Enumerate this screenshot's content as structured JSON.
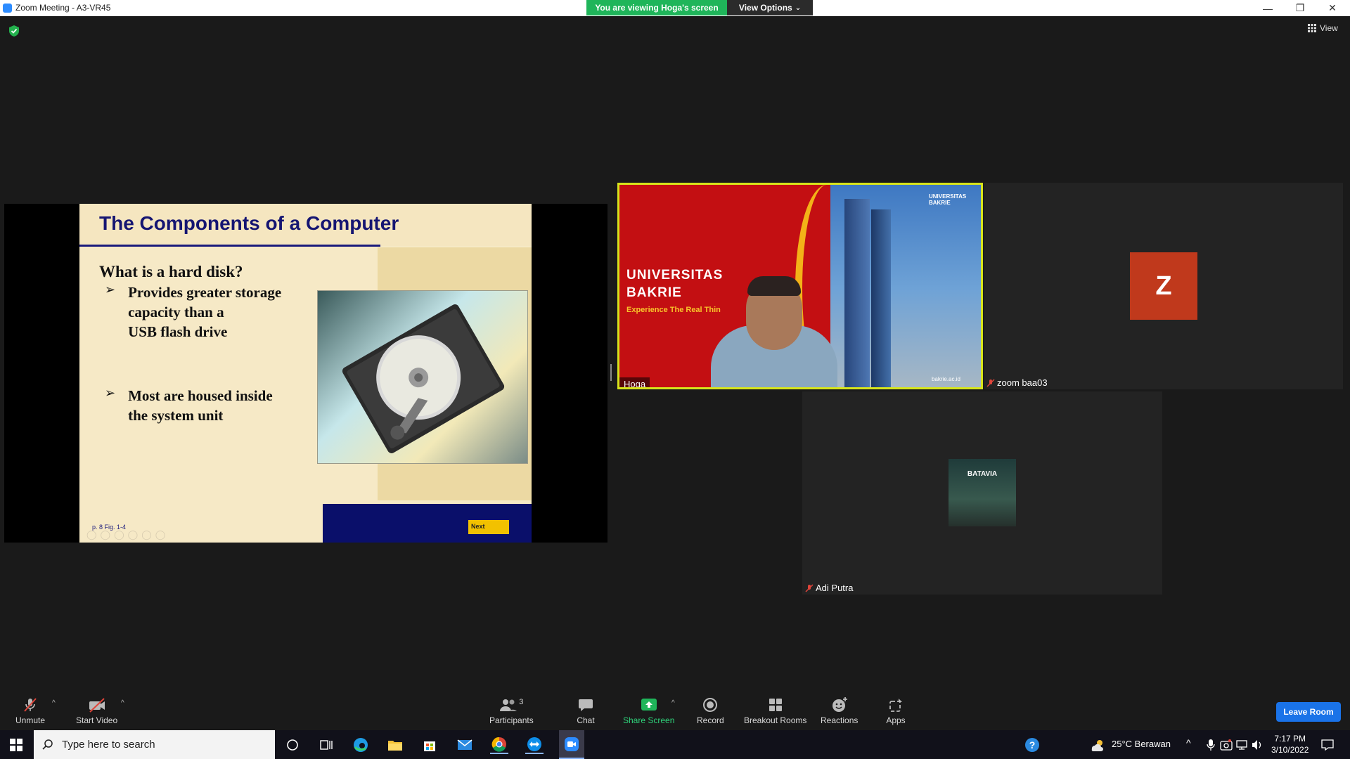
{
  "window": {
    "title": "Zoom Meeting - A3-VR45",
    "minimize": "—",
    "restore": "❐",
    "close": "✕"
  },
  "banner": {
    "viewing": "You are viewing Hoga's screen",
    "view_options": "View Options",
    "view_options_caret": "⌄"
  },
  "view_button": {
    "label": "View"
  },
  "slide": {
    "title": "The Components of a Computer",
    "question": "What is a hard disk?",
    "bullets": [
      [
        "Provides greater storage",
        "capacity than a",
        "USB flash drive"
      ],
      [
        "Most are housed inside",
        "the system unit"
      ]
    ],
    "arrow": "➢",
    "figure_ref": "p. 8 Fig. 1-4",
    "next_label": "Next"
  },
  "participants": {
    "hoga": {
      "name": "Hoga",
      "bg_headline_1": "UNIVERSITAS",
      "bg_headline_2": "BAKRIE",
      "bg_tagline": "Experience The Real Thin",
      "bg_logo": "UNIVERSITAS BAKRIE",
      "bg_url": "bakrie.ac.id"
    },
    "zoom": {
      "name": "zoom baa03",
      "initial": "Z"
    },
    "adi": {
      "name": "Adi Putra",
      "avatar_text": "BATAVIA"
    }
  },
  "toolbar": {
    "unmute": "Unmute",
    "start_video": "Start Video",
    "participants": "Participants",
    "participants_count": "3",
    "chat": "Chat",
    "share_screen": "Share Screen",
    "record": "Record",
    "breakout_rooms": "Breakout Rooms",
    "reactions": "Reactions",
    "apps": "Apps",
    "leave_room": "Leave Room",
    "caret": "^"
  },
  "taskbar": {
    "search_placeholder": "Type here to search",
    "weather": "25°C  Berawan",
    "time": "7:17 PM",
    "date": "3/10/2022"
  },
  "colors": {
    "share_green": "#1fb55a",
    "active_speaker": "#d7e41b",
    "avatar_bg": "#c0391c",
    "leave_blue": "#1a73e8"
  }
}
